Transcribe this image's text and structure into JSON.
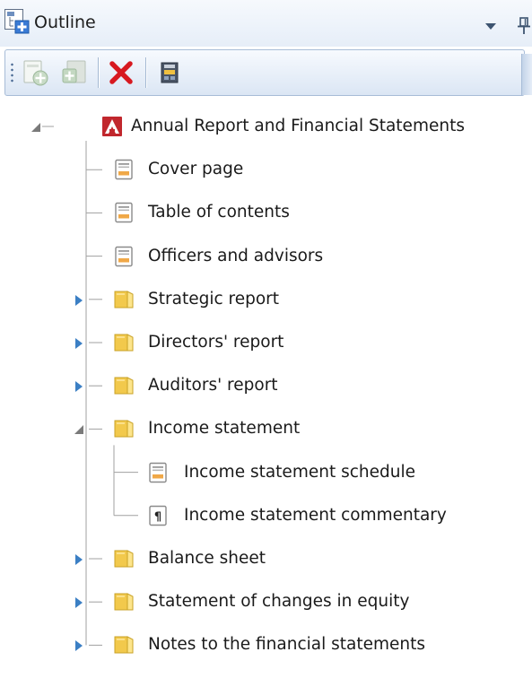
{
  "panel": {
    "title": "Outline",
    "icons": {
      "title": "outline-pane-icon",
      "menu": "chevron-down-icon",
      "pin": "pin-icon"
    }
  },
  "toolbar": {
    "buttons": [
      {
        "name": "add-page-button",
        "icon": "add-page-icon",
        "enabled": false
      },
      {
        "name": "add-section-button",
        "icon": "add-section-icon",
        "enabled": false
      },
      {
        "name": "delete-button",
        "icon": "delete-icon",
        "enabled": true
      },
      {
        "name": "properties-button",
        "icon": "properties-icon",
        "enabled": true
      }
    ]
  },
  "colors": {
    "folder": "#f2c94c",
    "page_outline": "#8a8a8a",
    "delete": "#d71920",
    "tree_line": "#a0a0a0",
    "expander_collapsed": "#3b7fc4",
    "expander_expanded": "#7a7a7a",
    "report_icon": "#c1272d"
  },
  "tree": {
    "root": {
      "label": "Annual Report and Financial Statements",
      "icon": "report-icon",
      "expanded": true
    },
    "items": [
      {
        "label": "Cover page",
        "icon": "page-icon",
        "has_children": false
      },
      {
        "label": "Table of contents",
        "icon": "page-icon",
        "has_children": false
      },
      {
        "label": "Officers and advisors",
        "icon": "page-icon",
        "has_children": false
      },
      {
        "label": "Strategic report",
        "icon": "folder-icon",
        "has_children": true,
        "expanded": false
      },
      {
        "label": "Directors' report",
        "icon": "folder-icon",
        "has_children": true,
        "expanded": false
      },
      {
        "label": "Auditors' report",
        "icon": "folder-icon",
        "has_children": true,
        "expanded": false
      },
      {
        "label": "Income statement",
        "icon": "folder-icon",
        "has_children": true,
        "expanded": true,
        "children": [
          {
            "label": "Income statement schedule",
            "icon": "page-icon"
          },
          {
            "label": "Income statement commentary",
            "icon": "paragraph-icon"
          }
        ]
      },
      {
        "label": "Balance sheet",
        "icon": "folder-icon",
        "has_children": true,
        "expanded": false
      },
      {
        "label": "Statement of changes in equity",
        "icon": "folder-icon",
        "has_children": true,
        "expanded": false
      },
      {
        "label": "Notes to the financial statements",
        "icon": "folder-icon",
        "has_children": true,
        "expanded": false
      }
    ]
  }
}
